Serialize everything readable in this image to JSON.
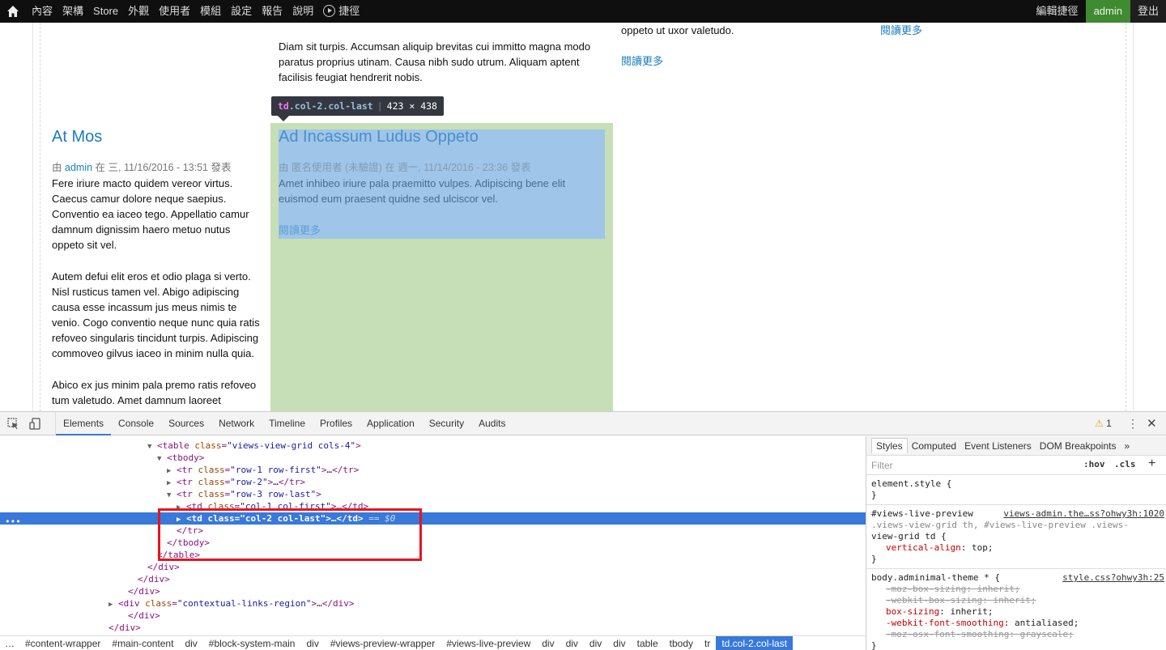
{
  "toolbar": {
    "menu": [
      "內容",
      "架構",
      "Store",
      "外觀",
      "使用者",
      "模組",
      "設定",
      "報告",
      "說明"
    ],
    "shortcuts": "捷徑",
    "edit_shortcuts": "編輯捷徑",
    "user": "admin",
    "logout": "登出"
  },
  "page": {
    "read_more": "閱讀更多",
    "top_center_text": [
      "Diam sit turpis. Accumsan aliquip brevitas cui immitto magna modo",
      "paratus proprius utinam. Causa nibh sudo utrum. Aliquam aptent",
      "facilisis feugiat hendrerit nobis."
    ],
    "top_right_text": "oppeto ut uxor valetudo.",
    "article1": {
      "title": "At Mos",
      "meta_prefix": "由",
      "author": "admin",
      "meta_suffix": "在 三, 11/16/2016 - 13:51 發表",
      "para1": [
        "Fere iriure macto quidem vereor virtus.",
        "Caecus camur dolore neque saepius.",
        "Conventio ea iaceo tego. Appellatio camur",
        "damnum dignissim haero metuo nutus",
        "oppeto sit vel."
      ],
      "para2": [
        "Autem defui elit eros et odio plaga si verto.",
        "Nisl rusticus tamen vel. Abigo adipiscing",
        "causa esse incassum jus meus nimis te",
        "venio. Cogo conventio neque nunc quia ratis",
        "refoveo singularis tincidunt turpis. Adipiscing",
        "commoveo gilvus iaceo in minim nulla quia."
      ],
      "para3": [
        "Abico ex jus minim pala premo ratis refoveo",
        "tum valetudo. Amet damnum laoreet"
      ]
    },
    "article2": {
      "title": "Ad Incassum Ludus Oppeto",
      "meta": "由 匿名使用者 (未驗證) 在 週一, 11/14/2016 - 23:36 發表",
      "body": [
        "Amet inhibeo iriure pala praemitto vulpes. Adipiscing bene elit",
        "euismod eum praesent quidne sed ulciscor vel."
      ]
    },
    "tooltip": {
      "tag": "td",
      "classes": ".col-2.col-last",
      "size": "423 × 438"
    }
  },
  "devtools": {
    "tabs": [
      "Elements",
      "Console",
      "Sources",
      "Network",
      "Timeline",
      "Profiles",
      "Application",
      "Security",
      "Audits"
    ],
    "warnings": "1",
    "dom_lines": [
      {
        "indent": 15,
        "tri": "▼",
        "html": "<table class=\"views-view-grid cols-4\">"
      },
      {
        "indent": 16,
        "tri": "▼",
        "html": "<tbody>"
      },
      {
        "indent": 17,
        "tri": "▶",
        "html": "<tr class=\"row-1 row-first\">…</tr>"
      },
      {
        "indent": 17,
        "tri": "▶",
        "html": "<tr class=\"row-2\">…</tr>"
      },
      {
        "indent": 17,
        "tri": "▼",
        "html": "<tr class=\"row-3 row-last\">"
      },
      {
        "indent": 18,
        "tri": "▶",
        "html": "<td class=\"col-1 col-first\">…</td>"
      },
      {
        "indent": 18,
        "tri": "▶",
        "html": "<td class=\"col-2 col-last\">…</td>",
        "selected": true,
        "suffix": "== $0"
      },
      {
        "indent": 17,
        "tri": "",
        "html": "</tr>"
      },
      {
        "indent": 16,
        "tri": "",
        "html": "</tbody>"
      },
      {
        "indent": 15,
        "tri": "",
        "html": "</table>"
      },
      {
        "indent": 14,
        "tri": "",
        "html": "</div>"
      },
      {
        "indent": 13,
        "tri": "",
        "html": "</div>"
      },
      {
        "indent": 12,
        "tri": "",
        "html": "</div>"
      },
      {
        "indent": 11,
        "tri": "▶",
        "html": "<div class=\"contextual-links-region\">…</div>"
      },
      {
        "indent": 12,
        "tri": "",
        "html": "</div>"
      },
      {
        "indent": 10,
        "tri": "",
        "html": "</div>"
      }
    ],
    "breadcrumbs": [
      "#content-wrapper",
      "#main-content",
      "div",
      "#block-system-main",
      "div",
      "#views-preview-wrapper",
      "#views-live-preview",
      "div",
      "div",
      "div",
      "div",
      "table",
      "tbody",
      "tr",
      "td.col-2.col-last"
    ],
    "styles": {
      "tabs": [
        "Styles",
        "Computed",
        "Event Listeners",
        "DOM Breakpoints"
      ],
      "filter_placeholder": "Filter",
      "hov": ":hov",
      "cls": ".cls",
      "element_style": "element.style {",
      "rule1_selector_a": "#views-live-preview",
      "rule1_source": "views-admin.the…ss?ohwy3h:1020",
      "rule1_selector_b": ".views-view-grid th, #views-live-preview .views-",
      "rule1_selector_c": "view-grid td {",
      "rule1_prop": "vertical-align",
      "rule1_val": "top;",
      "rule2_selector": "body.adminimal-theme * {",
      "rule2_source": "style.css?ohwy3h:25",
      "rule2_props": [
        {
          "name": "-moz-box-sizing",
          "val": "inherit;",
          "struck": true
        },
        {
          "name": "-webkit-box-sizing",
          "val": "inherit;",
          "struck": true
        },
        {
          "name": "box-sizing",
          "val": "inherit;",
          "struck": false
        },
        {
          "name": "-webkit-font-smoothing",
          "val": "antialiased;",
          "struck": false
        },
        {
          "name": "-moz-osx-font-smoothing",
          "val": "grayscale;",
          "struck": true
        }
      ]
    }
  }
}
